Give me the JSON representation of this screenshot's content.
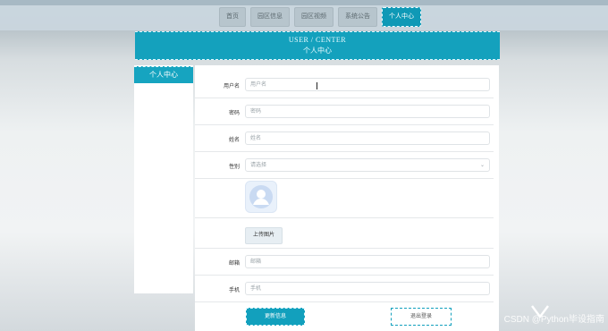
{
  "nav": {
    "items": [
      "首页",
      "园区信息",
      "园区视频",
      "系统公告",
      "个人中心"
    ],
    "active_index": 4
  },
  "banner": {
    "title_en": "USER / CENTER",
    "title_cn": "个人中心"
  },
  "sidebar": {
    "active_tab": "个人中心"
  },
  "form": {
    "username": {
      "label": "用户名",
      "value": "用户名"
    },
    "password": {
      "label": "密码",
      "placeholder": "密码"
    },
    "name": {
      "label": "姓名",
      "placeholder": "姓名"
    },
    "gender": {
      "label": "性别",
      "selected": "请选择"
    },
    "upload_label": "上传图片",
    "email": {
      "label": "邮箱",
      "placeholder": "邮箱"
    },
    "phone": {
      "label": "手机",
      "placeholder": "手机"
    }
  },
  "actions": {
    "update": "更新信息",
    "logout": "退出登录"
  },
  "watermark": "CSDN @Python毕设指南",
  "colors": {
    "accent": "#12a0bd",
    "nav_bg": "#b7c5cd"
  }
}
